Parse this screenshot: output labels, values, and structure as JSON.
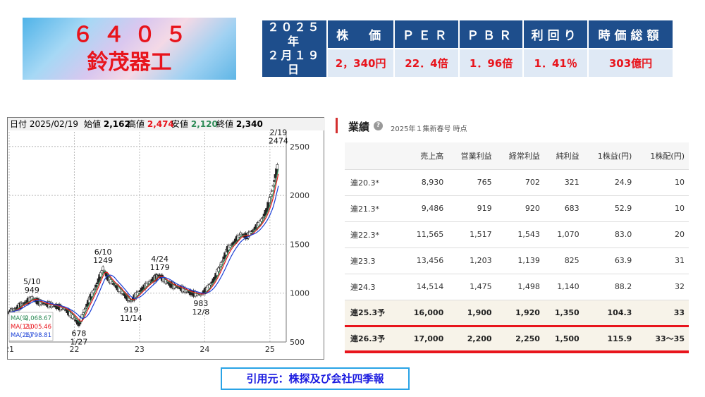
{
  "logo": {
    "code": "６４０５",
    "name": "鈴茂器工"
  },
  "indicators": {
    "date_line1": "２０２５年",
    "date_line2": "２月１９日",
    "headers": [
      "株　価",
      "ＰＥＲ",
      "ＰＢＲ",
      "利回り",
      "時価総額"
    ],
    "values": [
      "2，340円",
      "22．4倍",
      "1．96倍",
      "1．41％",
      "303億円"
    ]
  },
  "chart_header": {
    "date_label": "日付",
    "date": "2025/02/19",
    "open_label": "始値",
    "open": "2,162",
    "high_label": "高値",
    "high": "2,474",
    "low_label": "安値",
    "low": "2,120",
    "close_label": "終値",
    "close": "2,340"
  },
  "chart_data": {
    "type": "candlestick",
    "y_ticks": [
      500,
      1000,
      1500,
      2000,
      2500
    ],
    "ylim": [
      500,
      2650
    ],
    "x_ticks": [
      "21",
      "22",
      "23",
      "24",
      "25"
    ],
    "xlim": [
      2021.0,
      2025.25
    ],
    "annotations": [
      {
        "label_top": "5/10",
        "label_bottom": "949",
        "x": 2021.35,
        "y": 949
      },
      {
        "label_top": "678",
        "label_bottom": "1/27",
        "x": 2022.07,
        "y": 678
      },
      {
        "label_top": "6/10",
        "label_bottom": "1249",
        "x": 2022.44,
        "y": 1249
      },
      {
        "label_top": "919",
        "label_bottom": "11/14",
        "x": 2022.87,
        "y": 919
      },
      {
        "label_top": "4/24",
        "label_bottom": "1179",
        "x": 2023.31,
        "y": 1179
      },
      {
        "label_top": "983",
        "label_bottom": "12/8",
        "x": 2023.94,
        "y": 983
      },
      {
        "label_top": "2/19",
        "label_bottom": "2474",
        "x": 2025.13,
        "y": 2474
      }
    ],
    "moving_averages": [
      {
        "name": "MA(9)",
        "value": "2,068.67",
        "color": "#2e8b57"
      },
      {
        "name": "MA(13)",
        "value": "2,005.46",
        "color": "#e8141c"
      },
      {
        "name": "MA(26)",
        "value": "1,798.81",
        "color": "#1a3fd6"
      }
    ],
    "series": [
      {
        "name": "price",
        "values": [
          [
            2021.0,
            800
          ],
          [
            2021.08,
            830
          ],
          [
            2021.17,
            870
          ],
          [
            2021.25,
            900
          ],
          [
            2021.35,
            949
          ],
          [
            2021.45,
            910
          ],
          [
            2021.55,
            890
          ],
          [
            2021.65,
            880
          ],
          [
            2021.75,
            860
          ],
          [
            2021.85,
            840
          ],
          [
            2021.95,
            780
          ],
          [
            2022.07,
            678
          ],
          [
            2022.15,
            820
          ],
          [
            2022.25,
            960
          ],
          [
            2022.35,
            1100
          ],
          [
            2022.44,
            1249
          ],
          [
            2022.52,
            1150
          ],
          [
            2022.62,
            1080
          ],
          [
            2022.72,
            1020
          ],
          [
            2022.8,
            960
          ],
          [
            2022.87,
            919
          ],
          [
            2022.95,
            980
          ],
          [
            2023.05,
            1050
          ],
          [
            2023.15,
            1110
          ],
          [
            2023.25,
            1160
          ],
          [
            2023.31,
            1179
          ],
          [
            2023.4,
            1120
          ],
          [
            2023.5,
            1080
          ],
          [
            2023.6,
            1060
          ],
          [
            2023.7,
            1030
          ],
          [
            2023.8,
            1000
          ],
          [
            2023.94,
            983
          ],
          [
            2024.05,
            1050
          ],
          [
            2024.15,
            1150
          ],
          [
            2024.25,
            1300
          ],
          [
            2024.35,
            1450
          ],
          [
            2024.45,
            1520
          ],
          [
            2024.55,
            1600
          ],
          [
            2024.65,
            1580
          ],
          [
            2024.75,
            1650
          ],
          [
            2024.85,
            1720
          ],
          [
            2024.95,
            1850
          ],
          [
            2025.05,
            2100
          ],
          [
            2025.13,
            2340
          ]
        ]
      }
    ]
  },
  "earnings": {
    "title": "業績",
    "help_icon": "?",
    "as_of": "2025年１集新春号 時点",
    "columns": [
      "",
      "売上高",
      "営業利益",
      "経常利益",
      "純利益",
      "1株益(円)",
      "1株配(円)"
    ],
    "rows": [
      [
        "連20.3*",
        "8,930",
        "765",
        "702",
        "321",
        "24.9",
        "10"
      ],
      [
        "連21.3*",
        "9,486",
        "919",
        "920",
        "683",
        "52.9",
        "10"
      ],
      [
        "連22.3*",
        "11,565",
        "1,517",
        "1,543",
        "1,070",
        "83.0",
        "20"
      ],
      [
        "連23.3",
        "13,456",
        "1,203",
        "1,139",
        "825",
        "63.9",
        "31"
      ],
      [
        "連24.3",
        "14,514",
        "1,475",
        "1,498",
        "1,140",
        "88.2",
        "32"
      ],
      [
        "連25.3予",
        "16,000",
        "1,900",
        "1,920",
        "1,350",
        "104.3",
        "33"
      ],
      [
        "連26.3予",
        "17,000",
        "2,200",
        "2,250",
        "1,500",
        "115.9",
        "33〜35"
      ]
    ]
  },
  "source": "引用元：株探及び会社四季報"
}
